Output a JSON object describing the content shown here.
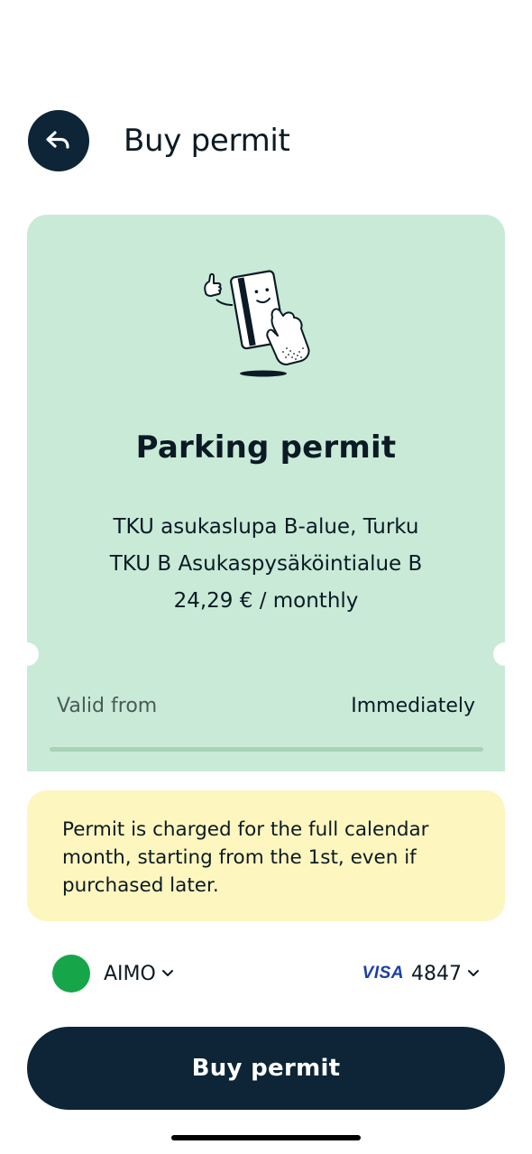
{
  "header": {
    "title": "Buy permit",
    "back_icon": "back-arrow-icon"
  },
  "permit_card": {
    "illustration": "thumbs-up-card-illustration",
    "title": "Parking permit",
    "area_line": "TKU asukaslupa B-alue, Turku",
    "zone_line": "TKU B Asukaspysäköintialue B",
    "price_line": "24,29 € / monthly",
    "valid_from_label": "Valid from",
    "valid_from_value": "Immediately",
    "background_color": "#c8ead7"
  },
  "notice": {
    "text_line1": "Permit is charged for the full calendar",
    "text_line2": "month, starting from the 1st, even if",
    "text_line3": "purchased later.",
    "background_color": "#fdf6bf"
  },
  "payment": {
    "provider_name": "AIMO",
    "provider_color": "#17a54a",
    "card_brand": "VISA",
    "card_last_digits": "4847",
    "dropdown_icon": "chevron-down-icon"
  },
  "buy_button": {
    "label": "Buy permit",
    "color": "#0d2536"
  }
}
